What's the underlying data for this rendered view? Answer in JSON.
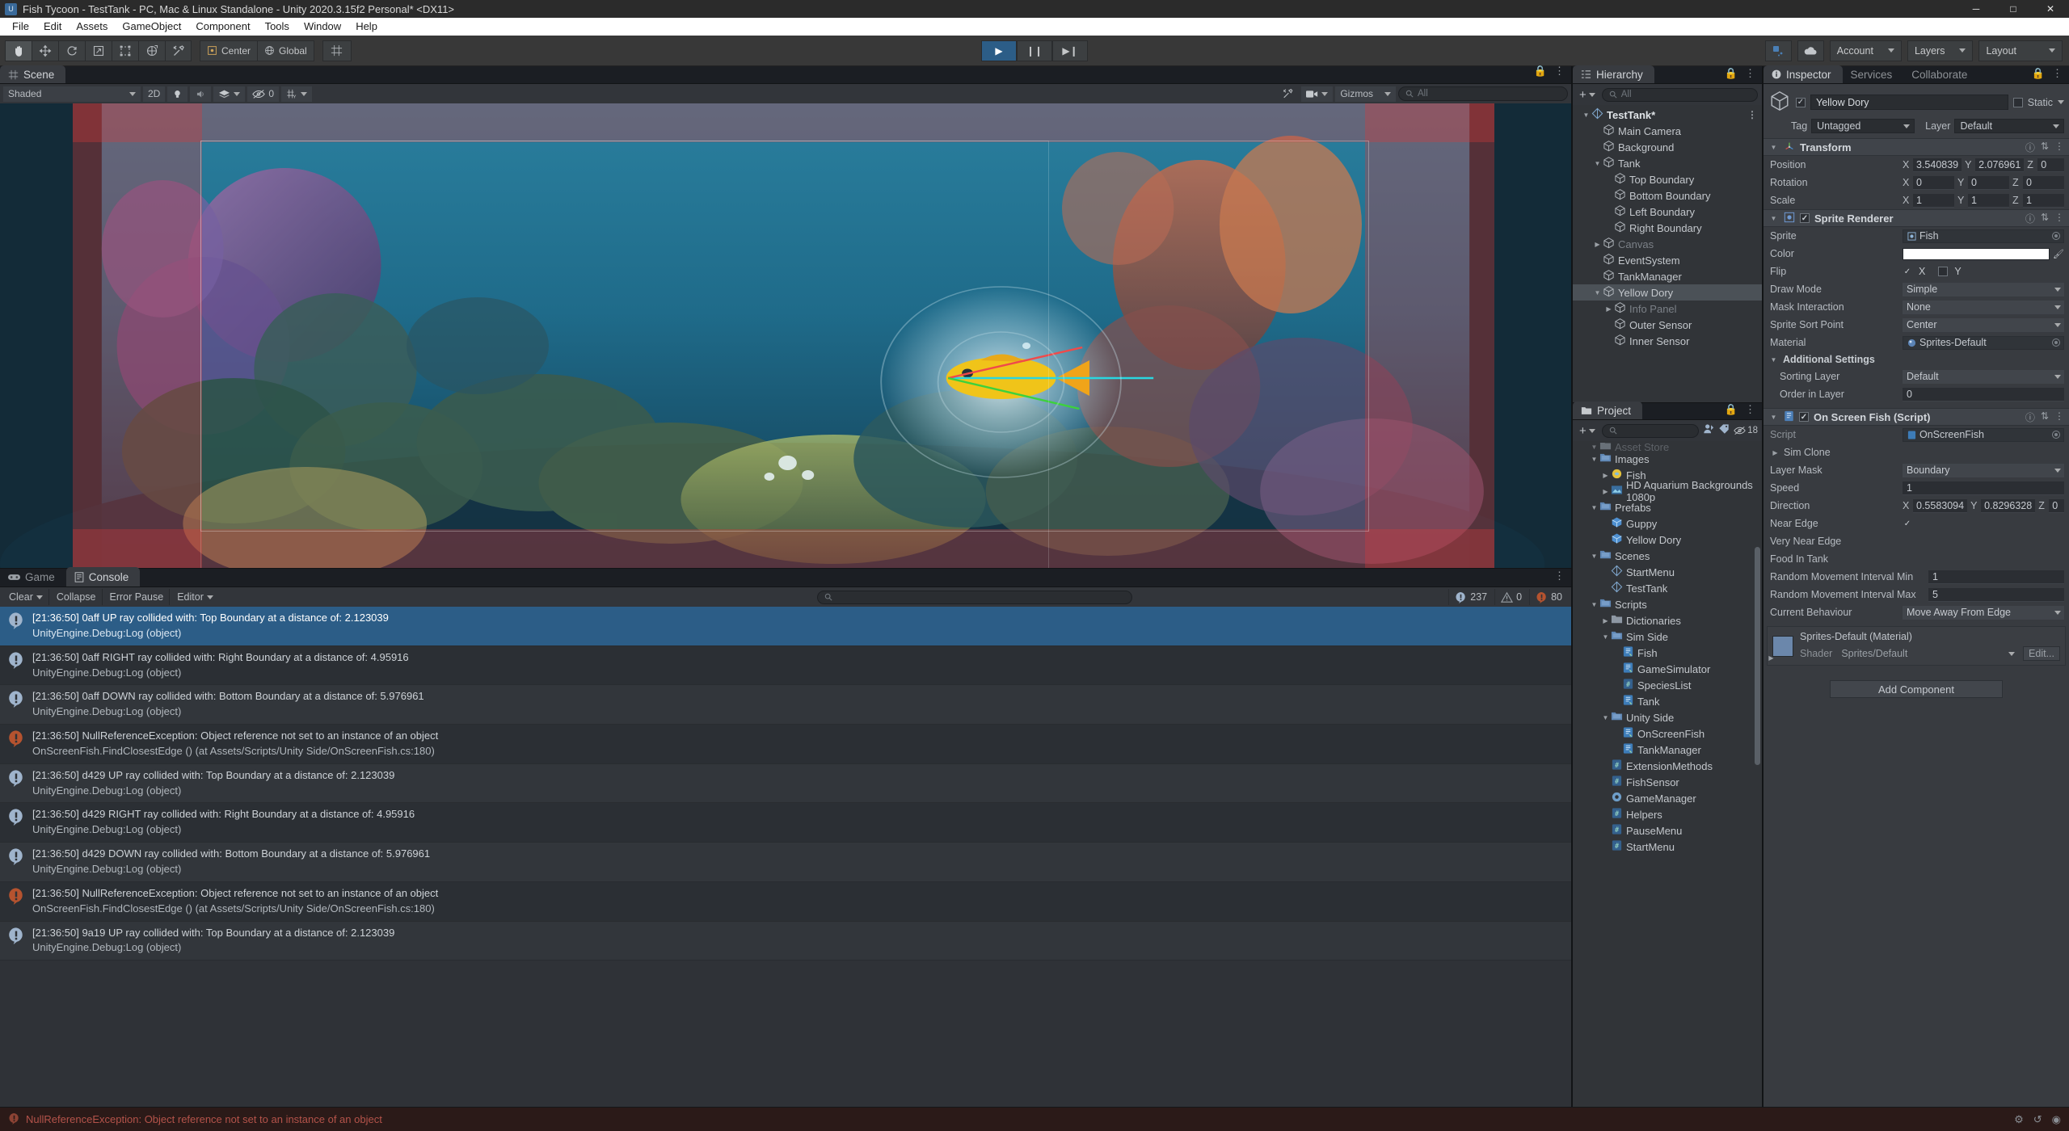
{
  "window": {
    "title": "Fish Tycoon - TestTank - PC, Mac & Linux Standalone - Unity 2020.3.15f2 Personal* <DX11>",
    "minimize": "─",
    "maximize": "□",
    "close": "✕"
  },
  "menubar": {
    "items": [
      "File",
      "Edit",
      "Assets",
      "GameObject",
      "Component",
      "Tools",
      "Window",
      "Help"
    ]
  },
  "toolbar": {
    "tools": [
      "hand-tool",
      "move-tool",
      "rotate-tool",
      "scale-tool",
      "rect-tool",
      "transform-tool",
      "custom-tool"
    ],
    "pivot_mode": "Center",
    "pivot_rotation": "Global",
    "play": "▶",
    "pause": "❙❙",
    "step": "▶❙",
    "account": "Account",
    "layers": "Layers",
    "layout": "Layout"
  },
  "scene": {
    "tab": "Scene",
    "shading_mode": "Shaded",
    "twod_toggle": "2D",
    "gizmos_label": "Gizmos",
    "hidden_count": "0",
    "search_placeholder": "All",
    "audio_icon": "audio-icon",
    "light_icon": "light-icon",
    "fx_icon": "effects-icon",
    "grid_icon": "grid-icon",
    "camera_icon": "camera-icon"
  },
  "console": {
    "game_tab": "Game",
    "console_tab": "Console",
    "clear": "Clear",
    "collapse": "Collapse",
    "error_pause": "Error Pause",
    "editor": "Editor",
    "search_placeholder": "",
    "counts": {
      "info": "237",
      "warning": "0",
      "error": "80"
    },
    "entries": [
      {
        "type": "log",
        "selected": true,
        "line1": "[21:36:50] 0aff UP ray collided with: Top Boundary at a distance of: 2.123039",
        "line2": "UnityEngine.Debug:Log (object)"
      },
      {
        "type": "log",
        "selected": false,
        "line1": "[21:36:50] 0aff RIGHT ray collided with: Right Boundary at a distance of: 4.95916",
        "line2": "UnityEngine.Debug:Log (object)"
      },
      {
        "type": "log",
        "selected": false,
        "line1": "[21:36:50] 0aff DOWN ray collided with: Bottom Boundary at a distance of: 5.976961",
        "line2": "UnityEngine.Debug:Log (object)"
      },
      {
        "type": "error",
        "selected": false,
        "line1": "[21:36:50] NullReferenceException: Object reference not set to an instance of an object",
        "line2": "OnScreenFish.FindClosestEdge () (at Assets/Scripts/Unity Side/OnScreenFish.cs:180)"
      },
      {
        "type": "log",
        "selected": false,
        "line1": "[21:36:50] d429 UP ray collided with: Top Boundary at a distance of: 2.123039",
        "line2": "UnityEngine.Debug:Log (object)"
      },
      {
        "type": "log",
        "selected": false,
        "line1": "[21:36:50] d429 RIGHT ray collided with: Right Boundary at a distance of: 4.95916",
        "line2": "UnityEngine.Debug:Log (object)"
      },
      {
        "type": "log",
        "selected": false,
        "line1": "[21:36:50] d429 DOWN ray collided with: Bottom Boundary at a distance of: 5.976961",
        "line2": "UnityEngine.Debug:Log (object)"
      },
      {
        "type": "error",
        "selected": false,
        "line1": "[21:36:50] NullReferenceException: Object reference not set to an instance of an object",
        "line2": "OnScreenFish.FindClosestEdge () (at Assets/Scripts/Unity Side/OnScreenFish.cs:180)"
      },
      {
        "type": "log",
        "selected": false,
        "line1": "[21:36:50] 9a19 UP ray collided with: Top Boundary at a distance of: 2.123039",
        "line2": "UnityEngine.Debug:Log (object)"
      }
    ]
  },
  "hierarchy": {
    "tab": "Hierarchy",
    "search_placeholder": "All",
    "items": [
      {
        "label": "TestTank*",
        "depth": 0,
        "icon": "scene-icon",
        "arrow": "down",
        "root": true,
        "selected": false,
        "dim": false
      },
      {
        "label": "Main Camera",
        "depth": 1,
        "icon": "object-icon",
        "arrow": "none",
        "root": false,
        "selected": false,
        "dim": false
      },
      {
        "label": "Background",
        "depth": 1,
        "icon": "object-icon",
        "arrow": "none",
        "root": false,
        "selected": false,
        "dim": false
      },
      {
        "label": "Tank",
        "depth": 1,
        "icon": "object-icon",
        "arrow": "down",
        "root": false,
        "selected": false,
        "dim": false
      },
      {
        "label": "Top Boundary",
        "depth": 2,
        "icon": "object-icon",
        "arrow": "none",
        "root": false,
        "selected": false,
        "dim": false
      },
      {
        "label": "Bottom Boundary",
        "depth": 2,
        "icon": "object-icon",
        "arrow": "none",
        "root": false,
        "selected": false,
        "dim": false
      },
      {
        "label": "Left Boundary",
        "depth": 2,
        "icon": "object-icon",
        "arrow": "none",
        "root": false,
        "selected": false,
        "dim": false
      },
      {
        "label": "Right Boundary",
        "depth": 2,
        "icon": "object-icon",
        "arrow": "none",
        "root": false,
        "selected": false,
        "dim": false
      },
      {
        "label": "Canvas",
        "depth": 1,
        "icon": "object-icon",
        "arrow": "right",
        "root": false,
        "selected": false,
        "dim": true
      },
      {
        "label": "EventSystem",
        "depth": 1,
        "icon": "object-icon",
        "arrow": "none",
        "root": false,
        "selected": false,
        "dim": false
      },
      {
        "label": "TankManager",
        "depth": 1,
        "icon": "object-icon",
        "arrow": "none",
        "root": false,
        "selected": false,
        "dim": false
      },
      {
        "label": "Yellow Dory",
        "depth": 1,
        "icon": "object-icon",
        "arrow": "down",
        "root": false,
        "selected": true,
        "dim": false
      },
      {
        "label": "Info Panel",
        "depth": 2,
        "icon": "object-icon",
        "arrow": "right",
        "root": false,
        "selected": false,
        "dim": true
      },
      {
        "label": "Outer Sensor",
        "depth": 2,
        "icon": "object-icon",
        "arrow": "none",
        "root": false,
        "selected": false,
        "dim": false
      },
      {
        "label": "Inner Sensor",
        "depth": 2,
        "icon": "object-icon",
        "arrow": "none",
        "root": false,
        "selected": false,
        "dim": false
      }
    ]
  },
  "project": {
    "tab": "Project",
    "search_placeholder": "",
    "visible_count": "18",
    "items": [
      {
        "label": "Asset Store",
        "depth": 1,
        "icon": "folder-icon",
        "arrow": "down",
        "clipped": true
      },
      {
        "label": "Images",
        "depth": 1,
        "icon": "folder-blue-icon",
        "arrow": "down",
        "clipped": false
      },
      {
        "label": "Fish",
        "depth": 2,
        "icon": "sprite-icon",
        "arrow": "right",
        "clipped": false
      },
      {
        "label": "HD Aquarium Backgrounds 1080p",
        "depth": 2,
        "icon": "image-icon",
        "arrow": "right",
        "clipped": false
      },
      {
        "label": "Prefabs",
        "depth": 1,
        "icon": "folder-blue-icon",
        "arrow": "down",
        "clipped": false
      },
      {
        "label": "Guppy",
        "depth": 2,
        "icon": "prefab-icon",
        "arrow": "none",
        "clipped": false
      },
      {
        "label": "Yellow Dory",
        "depth": 2,
        "icon": "prefab-icon",
        "arrow": "none",
        "clipped": false
      },
      {
        "label": "Scenes",
        "depth": 1,
        "icon": "folder-blue-icon",
        "arrow": "down",
        "clipped": false
      },
      {
        "label": "StartMenu",
        "depth": 2,
        "icon": "scene-icon",
        "arrow": "none",
        "clipped": false
      },
      {
        "label": "TestTank",
        "depth": 2,
        "icon": "scene-icon",
        "arrow": "none",
        "clipped": false
      },
      {
        "label": "Scripts",
        "depth": 1,
        "icon": "folder-blue-icon",
        "arrow": "down",
        "clipped": false
      },
      {
        "label": "Dictionaries",
        "depth": 2,
        "icon": "folder-icon",
        "arrow": "right",
        "clipped": false
      },
      {
        "label": "Sim Side",
        "depth": 2,
        "icon": "folder-blue-icon",
        "arrow": "down",
        "clipped": false
      },
      {
        "label": "Fish",
        "depth": 3,
        "icon": "script-icon",
        "arrow": "none",
        "clipped": false
      },
      {
        "label": "GameSimulator",
        "depth": 3,
        "icon": "script-icon",
        "arrow": "none",
        "clipped": false
      },
      {
        "label": "SpeciesList",
        "depth": 3,
        "icon": "cs-icon",
        "arrow": "none",
        "clipped": false
      },
      {
        "label": "Tank",
        "depth": 3,
        "icon": "script-icon",
        "arrow": "none",
        "clipped": false
      },
      {
        "label": "Unity Side",
        "depth": 2,
        "icon": "folder-blue-icon",
        "arrow": "down",
        "clipped": false
      },
      {
        "label": "OnScreenFish",
        "depth": 3,
        "icon": "script-icon",
        "arrow": "none",
        "clipped": false
      },
      {
        "label": "TankManager",
        "depth": 3,
        "icon": "script-icon",
        "arrow": "none",
        "clipped": false
      },
      {
        "label": "ExtensionMethods",
        "depth": 2,
        "icon": "cs-icon",
        "arrow": "none",
        "clipped": false
      },
      {
        "label": "FishSensor",
        "depth": 2,
        "icon": "cs-icon",
        "arrow": "none",
        "clipped": false
      },
      {
        "label": "GameManager",
        "depth": 2,
        "icon": "gear-icon",
        "arrow": "none",
        "clipped": false
      },
      {
        "label": "Helpers",
        "depth": 2,
        "icon": "cs-icon",
        "arrow": "none",
        "clipped": false
      },
      {
        "label": "PauseMenu",
        "depth": 2,
        "icon": "cs-icon",
        "arrow": "none",
        "clipped": false
      },
      {
        "label": "StartMenu",
        "depth": 2,
        "icon": "cs-icon",
        "arrow": "none",
        "clipped": false
      }
    ]
  },
  "inspector": {
    "tabs": [
      "Inspector",
      "Services",
      "Collaborate"
    ],
    "active_tab": "Inspector",
    "object_name": "Yellow Dory",
    "enabled": true,
    "static_label": "Static",
    "tag_label": "Tag",
    "tag_value": "Untagged",
    "layer_label": "Layer",
    "layer_value": "Default",
    "transform": {
      "title": "Transform",
      "rows": [
        {
          "label": "Position",
          "x": "3.540839",
          "y": "2.076961",
          "z": "0"
        },
        {
          "label": "Rotation",
          "x": "0",
          "y": "0",
          "z": "0"
        },
        {
          "label": "Scale",
          "x": "1",
          "y": "1",
          "z": "1"
        }
      ]
    },
    "sprite_renderer": {
      "title": "Sprite Renderer",
      "enabled": true,
      "sprite_label": "Sprite",
      "sprite_value": "Fish",
      "color_label": "Color",
      "color_value": "#FFFFFF",
      "flip_label": "Flip",
      "flip_x": "X",
      "flip_x_on": true,
      "flip_y": "Y",
      "flip_y_on": false,
      "draw_mode_label": "Draw Mode",
      "draw_mode_value": "Simple",
      "mask_label": "Mask Interaction",
      "mask_value": "None",
      "sort_point_label": "Sprite Sort Point",
      "sort_point_value": "Center",
      "material_label": "Material",
      "material_value": "Sprites-Default",
      "additional_label": "Additional Settings",
      "sorting_layer_label": "Sorting Layer",
      "sorting_layer_value": "Default",
      "order_label": "Order in Layer",
      "order_value": "0"
    },
    "on_screen_fish": {
      "title": "On Screen Fish (Script)",
      "enabled": true,
      "rows": [
        {
          "label": "Script",
          "type": "object",
          "value": "OnScreenFish",
          "dim": true
        },
        {
          "label": "Sim Clone",
          "type": "foldout",
          "value": ""
        },
        {
          "label": "Layer Mask",
          "type": "dropdown",
          "value": "Boundary"
        },
        {
          "label": "Speed",
          "type": "number",
          "value": "1"
        },
        {
          "label": "Direction",
          "type": "vector3",
          "x": "0.5583094",
          "y": "0.8296328",
          "z": "0"
        },
        {
          "label": "Near Edge",
          "type": "checkbox",
          "checked": true
        },
        {
          "label": "Very Near Edge",
          "type": "checkbox",
          "checked": false
        },
        {
          "label": "Food In Tank",
          "type": "checkbox",
          "checked": false
        },
        {
          "label": "Random Movement Interval Min",
          "type": "number",
          "value": "1"
        },
        {
          "label": "Random Movement Interval Max",
          "type": "number",
          "value": "5"
        },
        {
          "label": "Current Behaviour",
          "type": "dropdown",
          "value": "Move Away From Edge"
        }
      ]
    },
    "material_box": {
      "title": "Sprites-Default (Material)",
      "shader_label": "Shader",
      "shader_value": "Sprites/Default",
      "edit_label": "Edit..."
    },
    "add_component": "Add Component"
  },
  "statusbar": {
    "message": "NullReferenceException: Object reference not set to an instance of an object"
  },
  "colors": {
    "accent_blue": "#2c5d87",
    "error_red": "#b4534a",
    "panel_bg": "#383b40",
    "tree_bg": "#313438"
  }
}
